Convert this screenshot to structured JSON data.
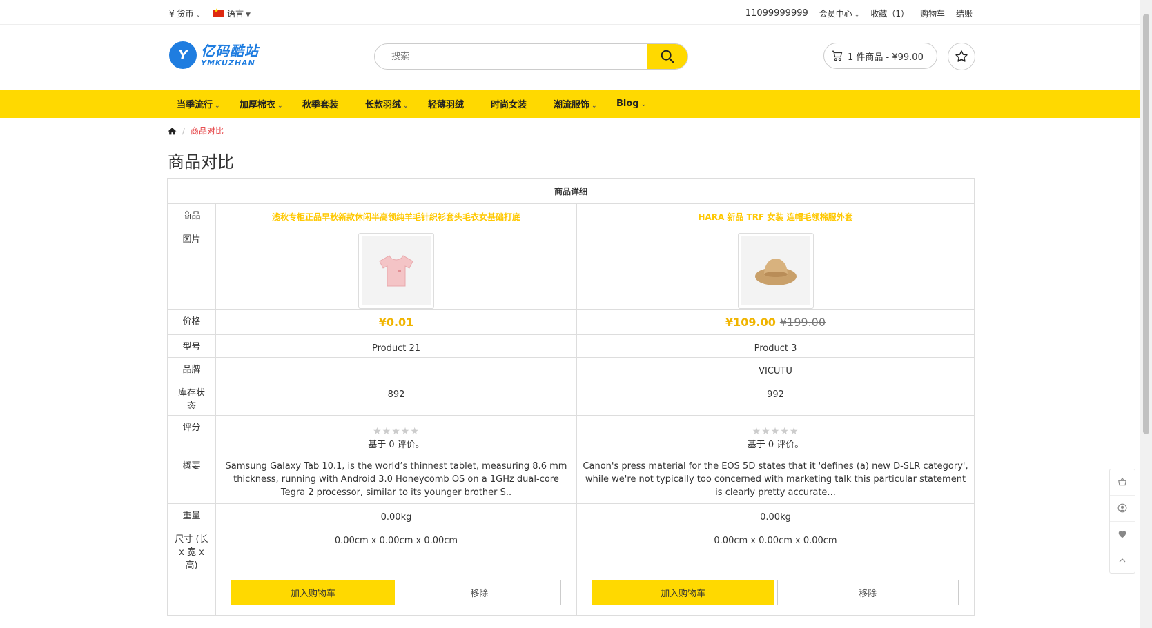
{
  "topbar": {
    "currency": "¥ 货币",
    "language": "语言",
    "phone": "11099999999",
    "member": "会员中心",
    "favorites": "收藏（1）",
    "cart": "购物车",
    "checkout": "结账"
  },
  "logo": {
    "mark": "Y",
    "cn": "亿码酷站",
    "en": "YMKUZHAN"
  },
  "search": {
    "placeholder": "搜索"
  },
  "cart_summary": "1 件商品 - ¥99.00",
  "nav": [
    "当季流行",
    "加厚棉衣",
    "秋季套装",
    "长款羽绒",
    "轻薄羽绒",
    "时尚女装",
    "潮流服饰",
    "Blog"
  ],
  "nav_dropdown": [
    true,
    true,
    false,
    true,
    false,
    false,
    true,
    true
  ],
  "breadcrumb": {
    "current": "商品对比"
  },
  "page_title": "商品对比",
  "table": {
    "header": "商品详细",
    "labels": {
      "product": "商品",
      "image": "图片",
      "price": "价格",
      "model": "型号",
      "brand": "品牌",
      "stock": "库存状态",
      "rating": "评分",
      "summary": "概要",
      "weight": "重量",
      "dimensions": "尺寸 (长 x 宽 x 高)"
    },
    "products": [
      {
        "name": "浅秋专柜正品早秋新款休闲半高领纯羊毛针织衫套头毛衣女基础打底",
        "image": "pink-tshirt",
        "price": "¥0.01",
        "old_price": "",
        "model": "Product 21",
        "brand": "",
        "stock": "892",
        "rating": 0,
        "reviews": "基于 0 评价。",
        "summary": "Samsung Galaxy Tab 10.1, is the world’s thinnest tablet, measuring 8.6 mm thickness, running with Android 3.0 Honeycomb OS on a 1GHz dual-core Tegra 2 processor, similar to its younger brother S..",
        "weight": "0.00kg",
        "dimensions": "0.00cm x 0.00cm x 0.00cm",
        "add_cart": "加入购物车",
        "remove": "移除"
      },
      {
        "name": "HARA 新品 TRF 女装 连帽毛领棉服外套",
        "image": "straw-hat",
        "price": "¥109.00",
        "old_price": "¥199.00",
        "model": "Product 3",
        "brand": "VICUTU",
        "stock": "992",
        "rating": 0,
        "reviews": "基于 0 评价。",
        "summary": "Canon's press material for the EOS 5D states that it 'defines (a) new D-SLR category', while we're not typically too concerned with marketing talk this particular statement is clearly pretty accurate...",
        "weight": "0.00kg",
        "dimensions": "0.00cm x 0.00cm x 0.00cm",
        "add_cart": "加入购物车",
        "remove": "移除"
      }
    ]
  },
  "side_tools": [
    "basket-icon",
    "user-icon",
    "heart-icon",
    "up-arrow-icon"
  ],
  "colors": {
    "accent": "#ffd900",
    "price": "#f0b400",
    "link_red": "#e4393c",
    "brand_blue": "#1f7de0"
  }
}
